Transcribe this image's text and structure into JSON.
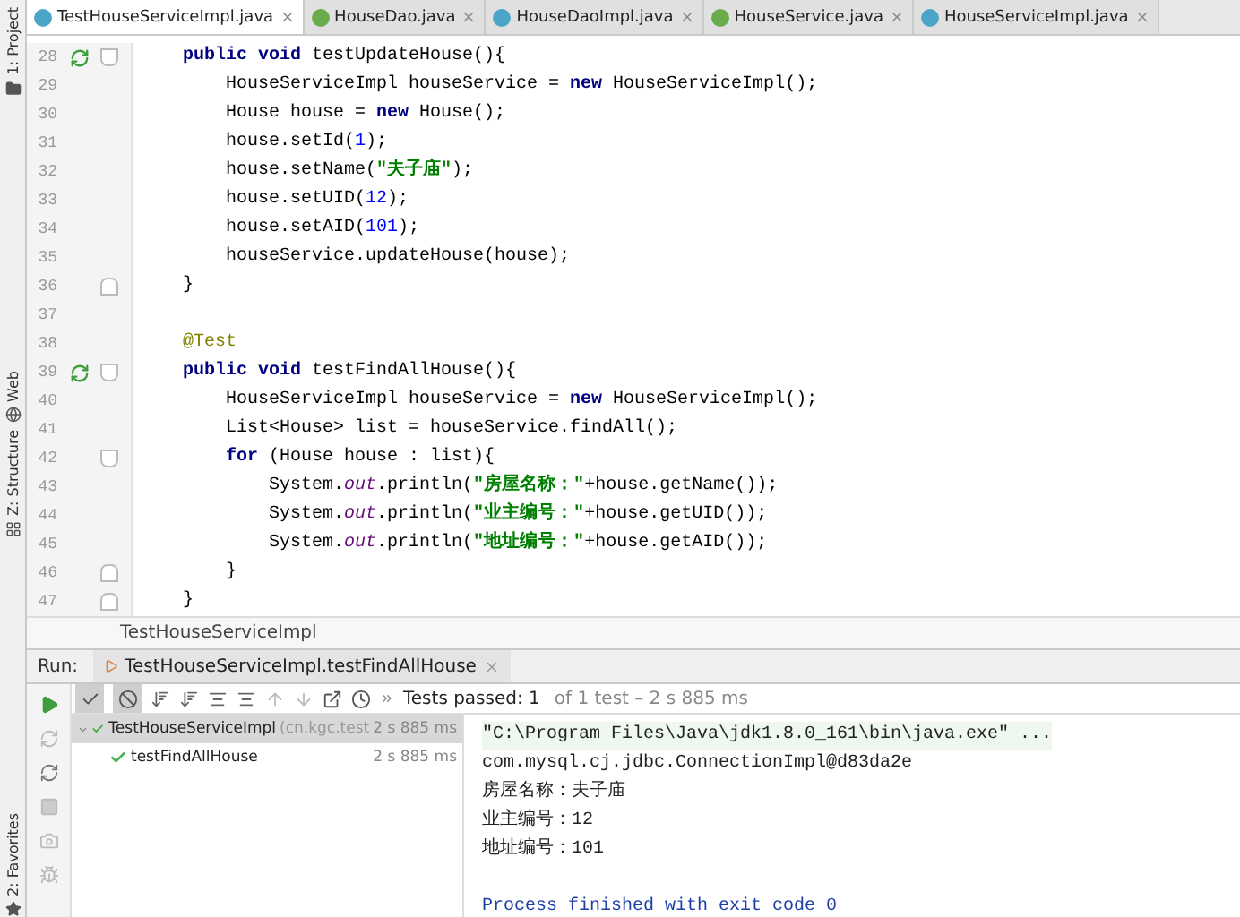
{
  "tool_strip": [
    {
      "label": "1: Project"
    },
    {
      "label": "Web"
    },
    {
      "label": "Z: Structure"
    },
    {
      "label": "2: Favorites"
    }
  ],
  "tabs": [
    {
      "label": "TestHouseServiceImpl.java",
      "kind": "class-run",
      "selected": true
    },
    {
      "label": "HouseDao.java",
      "kind": "interface",
      "selected": false
    },
    {
      "label": "HouseDaoImpl.java",
      "kind": "class-run",
      "selected": false
    },
    {
      "label": "HouseService.java",
      "kind": "interface",
      "selected": false
    },
    {
      "label": "HouseServiceImpl.java",
      "kind": "class",
      "selected": false
    }
  ],
  "code": [
    {
      "num": "28",
      "run": true,
      "fold_open": true,
      "tokens": [
        {
          "kind": "kw",
          "text": "public void"
        },
        {
          "kind": "plain",
          "text": " testUpdateHouse(){"
        }
      ],
      "children": [
        {
          "num": "29",
          "tokens": [
            {
              "kind": "plain",
              "text": "HouseServiceImpl houseService = "
            },
            {
              "kind": "kw",
              "text": "new"
            },
            {
              "kind": "plain",
              "text": " HouseServiceImpl();"
            }
          ]
        },
        {
          "num": "30",
          "tokens": [
            {
              "kind": "plain",
              "text": "House house = "
            },
            {
              "kind": "kw",
              "text": "new"
            },
            {
              "kind": "plain",
              "text": " House();"
            }
          ]
        },
        {
          "num": "31",
          "tokens": [
            {
              "kind": "plain",
              "text": "house.setId("
            },
            {
              "kind": "num",
              "text": "1"
            },
            {
              "kind": "plain",
              "text": ");"
            }
          ]
        },
        {
          "num": "32",
          "tokens": [
            {
              "kind": "plain",
              "text": "house.setName("
            },
            {
              "kind": "str",
              "text": "\"夫子庙\""
            },
            {
              "kind": "plain",
              "text": ");"
            }
          ]
        },
        {
          "num": "33",
          "tokens": [
            {
              "kind": "plain",
              "text": "house.setUID("
            },
            {
              "kind": "num",
              "text": "12"
            },
            {
              "kind": "plain",
              "text": ");"
            }
          ]
        },
        {
          "num": "34",
          "tokens": [
            {
              "kind": "plain",
              "text": "house.setAID("
            },
            {
              "kind": "num",
              "text": "101"
            },
            {
              "kind": "plain",
              "text": ");"
            }
          ]
        },
        {
          "num": "35",
          "tokens": [
            {
              "kind": "plain",
              "text": "houseService.updateHouse(house);"
            }
          ]
        }
      ]
    },
    {
      "num": "36",
      "fold_close": true,
      "tokens": [
        {
          "kind": "plain",
          "text": "}"
        }
      ]
    },
    {
      "num": "37"
    },
    {
      "num": "38",
      "tokens": [
        {
          "kind": "ann",
          "text": "@Test"
        }
      ]
    },
    {
      "num": "39",
      "run": true,
      "fold_open": true,
      "tokens": [
        {
          "kind": "kw",
          "text": "public void"
        },
        {
          "kind": "plain",
          "text": " testFindAllHouse(){"
        }
      ],
      "children": [
        {
          "num": "40",
          "tokens": [
            {
              "kind": "plain",
              "text": "HouseServiceImpl houseService = "
            },
            {
              "kind": "kw",
              "text": "new"
            },
            {
              "kind": "plain",
              "text": " HouseServiceImpl();"
            }
          ]
        },
        {
          "num": "41",
          "tokens": [
            {
              "kind": "plain",
              "text": "List<House> list = houseService.findAll();"
            }
          ]
        },
        {
          "num": "42",
          "fold_open": true,
          "tokens": [
            {
              "kind": "kw",
              "text": "for"
            },
            {
              "kind": "plain",
              "text": " (House house : list){"
            }
          ],
          "children": [
            {
              "num": "43",
              "tokens": [
                {
                  "kind": "plain",
                  "text": "System."
                },
                {
                  "kind": "field",
                  "text": "out"
                },
                {
                  "kind": "plain",
                  "text": ".println("
                },
                {
                  "kind": "str",
                  "text": "\"房屋名称：\""
                },
                {
                  "kind": "plain",
                  "text": "+house.getName());"
                }
              ]
            },
            {
              "num": "44",
              "tokens": [
                {
                  "kind": "plain",
                  "text": "System."
                },
                {
                  "kind": "field",
                  "text": "out"
                },
                {
                  "kind": "plain",
                  "text": ".println("
                },
                {
                  "kind": "str",
                  "text": "\"业主编号：\""
                },
                {
                  "kind": "plain",
                  "text": "+house.getUID());"
                }
              ]
            },
            {
              "num": "45",
              "tokens": [
                {
                  "kind": "plain",
                  "text": "System."
                },
                {
                  "kind": "field",
                  "text": "out"
                },
                {
                  "kind": "plain",
                  "text": ".println("
                },
                {
                  "kind": "str",
                  "text": "\"地址编号：\""
                },
                {
                  "kind": "plain",
                  "text": "+house.getAID());"
                }
              ]
            }
          ]
        },
        {
          "num": "46",
          "fold_close": true,
          "tokens": [
            {
              "kind": "plain",
              "text": "}"
            }
          ]
        }
      ]
    },
    {
      "num": "47",
      "fold_close": true,
      "tokens": [
        {
          "kind": "plain",
          "text": "}"
        }
      ]
    }
  ],
  "breadcrumb": "TestHouseServiceImpl",
  "run": {
    "label": "Run:",
    "tab": "TestHouseServiceImpl.testFindAllHouse",
    "status": {
      "label": "Tests passed: 1",
      "detail": "of 1 test – 2 s 885 ms"
    },
    "tree": [
      {
        "label": "TestHouseServiceImpl",
        "detail": "(cn.kgc.test",
        "time": "2 s 885 ms",
        "expanded": true,
        "selected": true,
        "children": [
          {
            "label": "testFindAllHouse",
            "time": "2 s 885 ms",
            "selected": false
          }
        ]
      }
    ],
    "console": [
      {
        "kind": "command",
        "text": "\"C:\\Program Files\\Java\\jdk1.8.0_161\\bin\\java.exe\" ..."
      },
      {
        "kind": "output",
        "text": "com.mysql.cj.jdbc.ConnectionImpl@d83da2e"
      },
      {
        "kind": "output",
        "text": "房屋名称：夫子庙"
      },
      {
        "kind": "output",
        "text": "业主编号：12"
      },
      {
        "kind": "output",
        "text": "地址编号：101"
      },
      {
        "kind": "exit",
        "text": "Process finished with exit code 0"
      }
    ]
  }
}
